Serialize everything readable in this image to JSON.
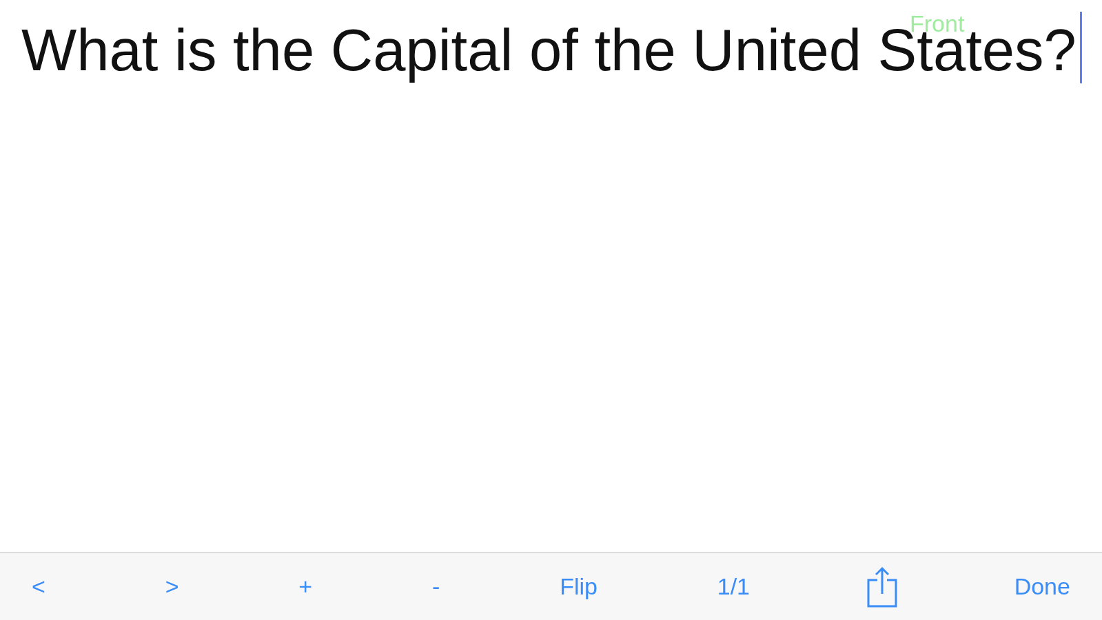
{
  "card": {
    "side_label": "Front",
    "text": "What is the Capital of the United States?",
    "editing": true
  },
  "toolbar": {
    "items": [
      {
        "kind": "text",
        "label": "<"
      },
      {
        "kind": "text",
        "label": ">"
      },
      {
        "kind": "text",
        "label": "+"
      },
      {
        "kind": "text",
        "label": "-"
      },
      {
        "kind": "text",
        "label": "Flip"
      },
      {
        "kind": "text",
        "label": "1/1"
      },
      {
        "kind": "share"
      },
      {
        "kind": "text",
        "label": "Done"
      }
    ]
  }
}
